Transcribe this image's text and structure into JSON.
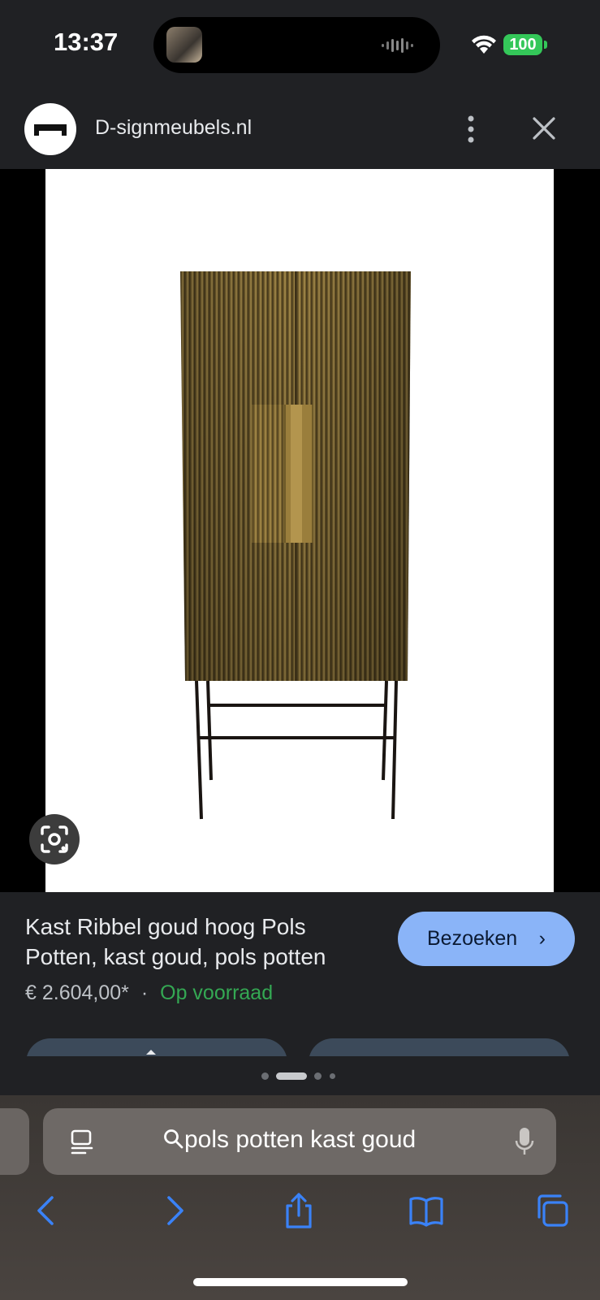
{
  "status": {
    "time": "13:37",
    "battery": "100",
    "battery_color": "#34c759"
  },
  "header": {
    "site_name": "D-signmeubels.nl",
    "site_icon": "site-logo-icon",
    "more_icon": "more-vert-icon",
    "close_icon": "close-icon"
  },
  "product": {
    "image": "gold-ribbed-cabinet",
    "title": "Kast Ribbel goud hoog Pols Potten, kast goud, pols potten",
    "visit_label": "Bezoeken",
    "visit_chevron": "›",
    "price": "€ 2.604,00*",
    "separator": "·",
    "stock": "Op voorraad",
    "stock_color": "#34a853",
    "accent": "#8ab4f8"
  },
  "pager": {
    "count": 4,
    "active": 1
  },
  "search": {
    "query": "pols potten kast goud",
    "search_icon": "search-icon",
    "mic_icon": "mic-icon",
    "tabs_icon": "tabs-list-icon"
  },
  "toolbar": {
    "icons": [
      "back-icon",
      "forward-icon",
      "share-icon",
      "bookmarks-icon",
      "tabs-icon"
    ],
    "color": "#3a82f7"
  }
}
